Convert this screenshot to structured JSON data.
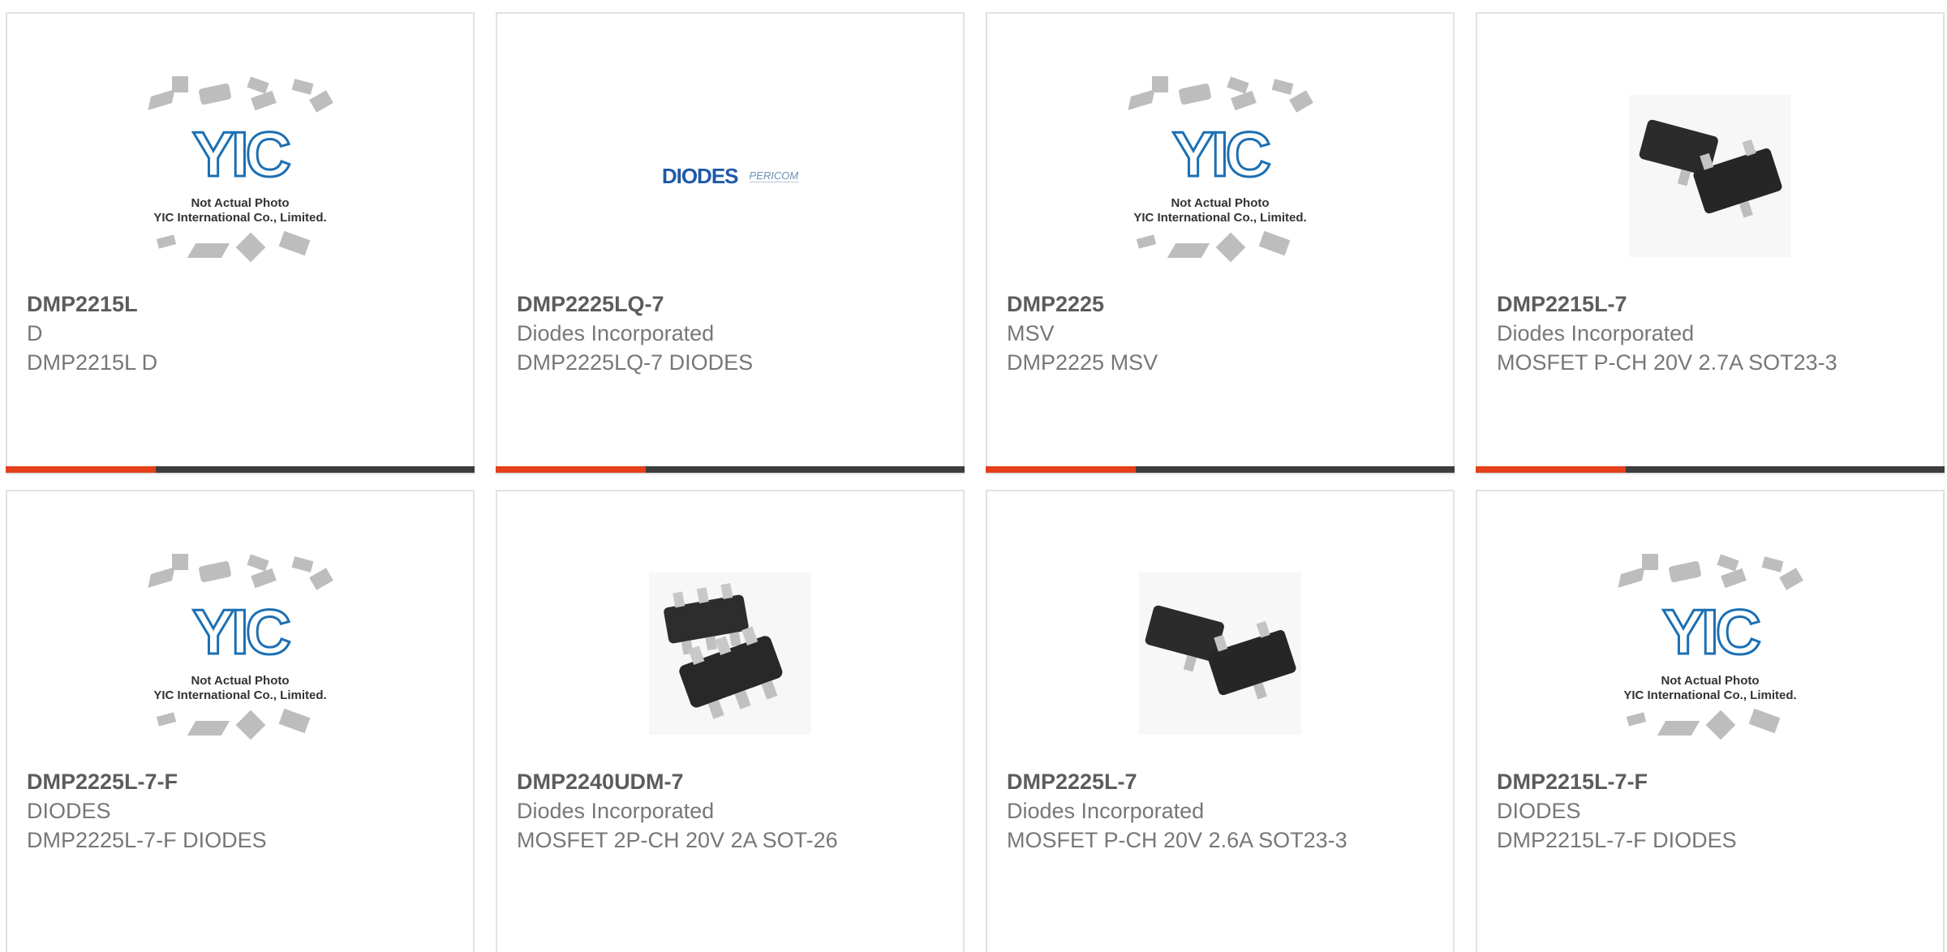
{
  "products": [
    {
      "part": "DMP2215L",
      "manufacturer": "D",
      "description": "DMP2215L D",
      "image": "yic-placeholder"
    },
    {
      "part": "DMP2225LQ-7",
      "manufacturer": "Diodes Incorporated",
      "description": "DMP2225LQ-7 DIODES",
      "image": "diodes-logo"
    },
    {
      "part": "DMP2225",
      "manufacturer": "MSV",
      "description": "DMP2225 MSV",
      "image": "yic-placeholder"
    },
    {
      "part": "DMP2215L-7",
      "manufacturer": "Diodes Incorporated",
      "description": "MOSFET P-CH 20V 2.7A SOT23-3",
      "image": "sot23-photo"
    },
    {
      "part": "DMP2225L-7-F",
      "manufacturer": "DIODES",
      "description": "DMP2225L-7-F DIODES",
      "image": "yic-placeholder"
    },
    {
      "part": "DMP2240UDM-7",
      "manufacturer": "Diodes Incorporated",
      "description": "MOSFET 2P-CH 20V 2A SOT-26",
      "image": "sot26-photo"
    },
    {
      "part": "DMP2225L-7",
      "manufacturer": "Diodes Incorporated",
      "description": "MOSFET P-CH 20V 2.6A SOT23-3",
      "image": "sot23-photo"
    },
    {
      "part": "DMP2215L-7-F",
      "manufacturer": "DIODES",
      "description": "DMP2215L-7-F DIODES",
      "image": "yic-placeholder"
    }
  ],
  "placeholder": {
    "logo_text": "YIC",
    "caption_line1": "Not Actual Photo",
    "caption_line2": "YIC International Co., Limited."
  },
  "diodes_logo": {
    "brand": "DIODES",
    "sub": "PERICOM"
  },
  "colors": {
    "accent": "#e4401a",
    "bar": "#3d3d3d",
    "title": "#5c5c5c",
    "text": "#777777",
    "yic_blue": "#1b6fb3"
  }
}
